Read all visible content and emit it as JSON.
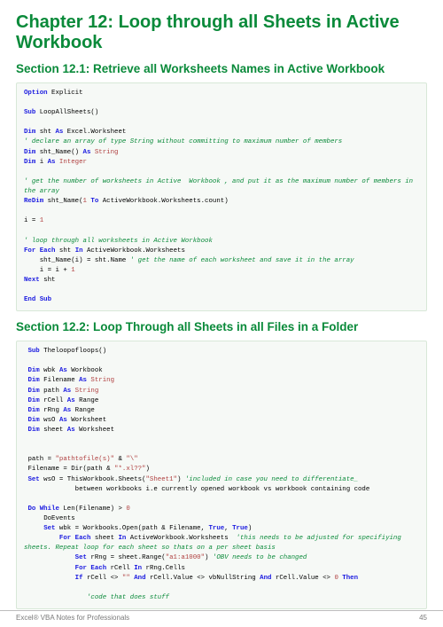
{
  "chapter_title": "Chapter 12: Loop through all Sheets in Active Workbook",
  "section1": {
    "title": "Section 12.1: Retrieve all Worksheets Names in Active Workbook",
    "code": {
      "l1_option": "Option",
      "l1_explicit": " Explicit",
      "l3_sub": "Sub",
      "l3_name": " LoopAllSheets()",
      "l5_dim": "Dim",
      "l5_rest": " sht ",
      "l5_as": "As",
      "l5_type": " Excel.Worksheet",
      "l6_comment": "' declare an array of type String without committing to maximum number of members",
      "l7_dim": "Dim",
      "l7_rest": " sht_Name() ",
      "l7_as": "As",
      "l7_type": " String",
      "l8_dim": "Dim",
      "l8_rest": " i ",
      "l8_as": "As",
      "l8_type": " Integer",
      "l10_comment": "' get the number of worksheets in Active  Workbook , and put it as the maximum number of members in the array",
      "l11_redim": "ReDim",
      "l11_rest": " sht_Name(",
      "l11_one": "1",
      "l11_to": " To",
      "l11_rest2": " ActiveWorkbook.Worksheets.count)",
      "l13": "i = ",
      "l13_one": "1",
      "l15_comment": "' loop through all worksheets in Active Workbook",
      "l16_for": "For",
      "l16_each": " Each",
      "l16_rest": " sht ",
      "l16_in": "In",
      "l16_rest2": " ActiveWorkbook.Worksheets",
      "l17_rest": "    sht_Name(i) = sht.Name ",
      "l17_comment": "' get the name of each worksheet and save it in the array",
      "l18": "    i = i + ",
      "l18_one": "1",
      "l19_next": "Next",
      "l19_rest": " sht",
      "l21_end": "End",
      "l21_sub": " Sub"
    }
  },
  "section2": {
    "title": "Section 12.2: Loop Through all Sheets in all Files in a Folder",
    "code": {
      "l1_sub": "Sub",
      "l1_name": " Theloopofloops()",
      "l3_dim": "Dim",
      "l3_rest": " wbk ",
      "l3_as": "As",
      "l3_type": " Workbook",
      "l4_dim": "Dim",
      "l4_rest": " Filename ",
      "l4_as": "As",
      "l4_type": " String",
      "l5_dim": "Dim",
      "l5_rest": " path ",
      "l5_as": "As",
      "l5_type": " String",
      "l6_dim": "Dim",
      "l6_rest": " rCell ",
      "l6_as": "As",
      "l6_type": " Range",
      "l7_dim": "Dim",
      "l7_rest": " rRng ",
      "l7_as": "As",
      "l7_type": " Range",
      "l8_dim": "Dim",
      "l8_rest": " wsO ",
      "l8_as": "As",
      "l8_type": " Worksheet",
      "l9_dim": "Dim",
      "l9_rest": " sheet ",
      "l9_as": "As",
      "l9_type": " Worksheet",
      "l11_a": " path = ",
      "l11_s1": "\"pathtofile(s)\"",
      "l11_b": " & ",
      "l11_s2": "\"\\\"",
      "l12_a": " Filename = Dir(path & ",
      "l12_s1": "\"*.xl??\"",
      "l12_b": ")",
      "l13_set": " Set",
      "l13_a": " wsO = ThisWorkbook.Sheets(",
      "l13_s1": "\"Sheet1\"",
      "l13_b": ") ",
      "l13_comment": "'included in case you need to differentiate_",
      "l14": "             between workbooks i.e currently opened workbook vs workbook containing code",
      "l16_do": " Do",
      "l16_while": " While",
      "l16_rest": " Len(Filename) > ",
      "l16_zero": "0",
      "l17": "     DoEvents",
      "l18_set": "     Set",
      "l18_rest": " wbk = Workbooks.Open(path & Filename, ",
      "l18_true1": "True",
      "l18_c": ", ",
      "l18_true2": "True",
      "l18_end": ")",
      "l19_for": "         For",
      "l19_each": " Each",
      "l19_rest": " sheet ",
      "l19_in": "In",
      "l19_rest2": " ActiveWorkbook.Worksheets  ",
      "l19_comment": "'this needs to be adjusted for specifiying sheets. Repeat loop for each sheet so thats on a per sheet basis",
      "l20_set": "             Set",
      "l20_rest": " rRng = sheet.Range(",
      "l20_s1": "\"a1:a1000\"",
      "l20_b": ") ",
      "l20_comment": "'OBV needs to be changed",
      "l21_for": "             For",
      "l21_each": " Each",
      "l21_rest": " rCell ",
      "l21_in": "In",
      "l21_rest2": " rRng.Cells",
      "l22_if": "             If",
      "l22_rest": " rCell <> ",
      "l22_s1": "\"\"",
      "l22_and1": " And",
      "l22_rest2": " rCell.Value <> vbNullString ",
      "l22_and2": "And",
      "l22_rest3": " rCell.Value <> ",
      "l22_zero": "0",
      "l22_then": " Then",
      "l24_comment": "                'code that does stuff"
    }
  },
  "footer": {
    "left": "Excel® VBA Notes for Professionals",
    "right": "45"
  }
}
